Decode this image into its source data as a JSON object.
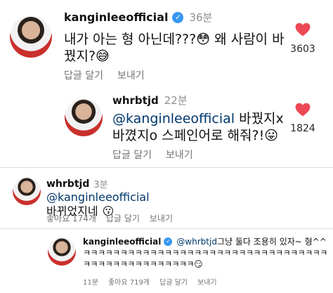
{
  "c1": {
    "username": "kanginleeofficial",
    "verified_icon": "verified-badge-icon",
    "time": "36분",
    "text_part1": "내가 아는 형 아닌데???",
    "emoji1": "😳",
    "text_part2": " 왜 사람이 바꿨지?",
    "emoji2": "😅",
    "reply_label": "답글 달기",
    "send_label": "보내기",
    "likes": "3603",
    "heart_color": "#ed4956"
  },
  "c2": {
    "username": "whrbtjd",
    "time": "22분",
    "mention": "@kanginleeofficial",
    "text": " 바꿨지x 바꼈지o 스페인어로 해줘?!",
    "emoji": "😛",
    "reply_label": "답글 달기",
    "send_label": "보내기",
    "likes": "1824",
    "heart_color": "#ed4956"
  },
  "c3": {
    "username": "whrbtjd",
    "time": "3분",
    "mention": "@kanginleeofficial",
    "text": " 바뀌었지네",
    "emoji": "😗",
    "likes_text": "좋아요 174개",
    "reply_label": "답글 달기",
    "send_label": "보내기"
  },
  "c4": {
    "username": "kanginleeofficial",
    "verified_icon": "verified-badge-icon",
    "mention": "@whrbtjd",
    "text": " 그냥 둘다 조용히 있자~ 형^^",
    "laugh_text": "ㅋㅋㅋㅋㅋㅋㅋㅋㅋㅋㅋㅋㅋㅋㅋㅋㅋㅋㅋㅋㅋㅋㅋㅋㅋㅋㅋㅋㅋㅋㅋㅋㅋㅋㅋㅋㅋㅋㅋㅋㅋㅋㅋㅋㅋㅋㅋㅋ",
    "emoji": "😏",
    "time": "11분",
    "likes_text": "좋아요 719개",
    "reply_label": "답글 달기",
    "send_label": "보내기"
  },
  "colors": {
    "mention": "#00376b",
    "verified": "#3897f0",
    "muted": "#737373"
  }
}
